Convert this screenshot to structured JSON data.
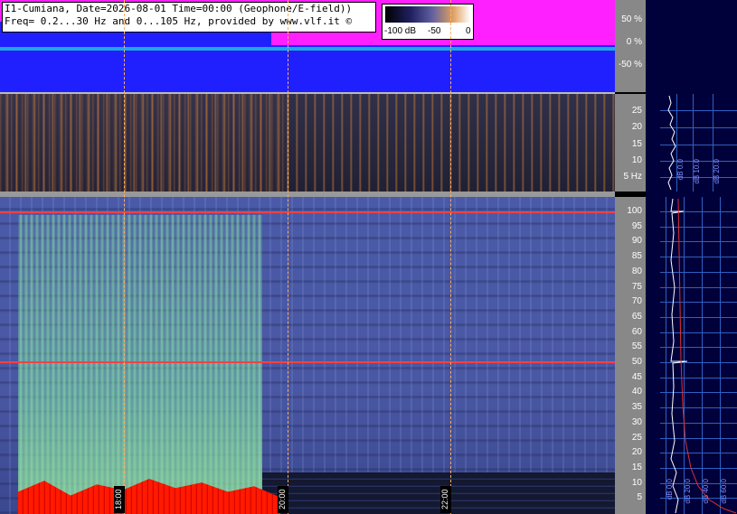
{
  "header": {
    "line1": "I1-Cumiana, Date=2026-08-01 Time=00:00 (Geophone/E-field))",
    "line2": "Freq= 0.2...30 Hz and 0...105 Hz, provided by www.vlf.it ©"
  },
  "colorbar": {
    "min_label": "-100 dB",
    "mid_label": "-50",
    "max_label": "0"
  },
  "wave_scale": [
    "50 %",
    "0 %",
    "-50 %"
  ],
  "low_scale": [
    "25",
    "20",
    "15",
    "10",
    "5 Hz"
  ],
  "main_scale": [
    "100",
    "95",
    "90",
    "85",
    "80",
    "75",
    "70",
    "65",
    "60",
    "55",
    "50",
    "45",
    "40",
    "35",
    "30",
    "25",
    "20",
    "15",
    "10",
    "5"
  ],
  "time_labels": [
    "18:00",
    "20:00",
    "22:00"
  ],
  "side_axis_labels": {
    "low": [
      "dB 0.0",
      "dB 10.0",
      "dB 20.0"
    ],
    "main": [
      "dB 0.0",
      "dB 20.0",
      "dB 40.0",
      "dB 60.0"
    ]
  },
  "colors": {
    "wave_bg": "#2020ff",
    "magenta": "#ff20ff",
    "accent_red": "#ff4040",
    "scale_bg": "#888888"
  }
}
